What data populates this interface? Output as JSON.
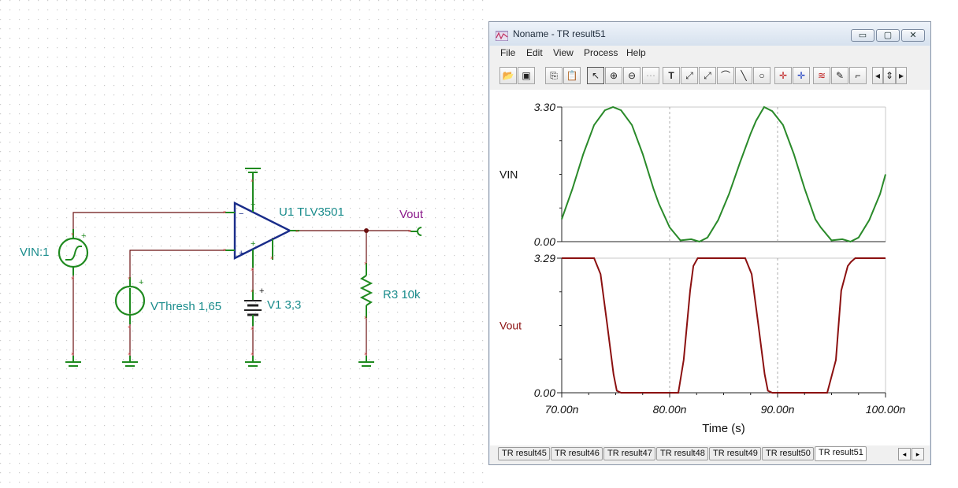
{
  "schematic": {
    "vin_label": "VIN:1",
    "vthresh_label": "VThresh 1,65",
    "opamp_label": "U1 TLV3501",
    "v1_label": "V1 3,3",
    "r3_label": "R3 10k",
    "vout_label": "Vout",
    "plus": "+",
    "minus": "−"
  },
  "window": {
    "title": "Noname - TR result51",
    "menu": [
      "File",
      "Edit",
      "View",
      "Process",
      "Help"
    ],
    "buttons": {
      "minimize": "▭",
      "maximize": "▢",
      "close": "✕"
    }
  },
  "toolbar": {
    "icons": [
      "open-icon",
      "save-icon",
      "copy-icon",
      "paste-icon",
      "pointer-icon",
      "zoom-in-icon",
      "zoom-100-icon",
      "grid-icon",
      "text-icon",
      "cursor-a-icon",
      "cursor-b-icon",
      "curve-icon",
      "line-icon",
      "circle-icon",
      "cursor-marker-a-icon",
      "cursor-marker-b-icon",
      "waveform-icon",
      "probe-icon",
      "flag-icon",
      "scroll-left-icon",
      "scroll-up-down-icon",
      "scroll-right-icon"
    ]
  },
  "tabs": [
    "TR result45",
    "TR result46",
    "TR result47",
    "TR result48",
    "TR result49",
    "TR result50",
    "TR result51"
  ],
  "active_tab": "TR result51",
  "chart_data": {
    "type": "line",
    "xlabel": "Time (s)",
    "x_ticks": [
      "70.00n",
      "80.00n",
      "90.00n",
      "100.00n"
    ],
    "xlim": [
      70,
      100
    ],
    "panels": [
      {
        "name": "VIN",
        "color": "#2a8a2a",
        "ylim": [
          0,
          3.3
        ],
        "y_ticks": [
          "0.00",
          "3.30"
        ],
        "x": [
          70,
          71,
          72,
          73,
          74,
          74.75,
          75.5,
          76.5,
          77.5,
          78.5,
          79,
          80,
          81,
          82,
          82.75,
          83.5,
          84.5,
          85.5,
          86.5,
          87.5,
          88,
          88.75,
          89.5,
          90.5,
          91.5,
          92.5,
          93.5,
          94,
          95,
          96,
          96.75,
          97.5,
          98.5,
          99.5,
          100
        ],
        "y": [
          0.55,
          1.3,
          2.15,
          2.86,
          3.22,
          3.3,
          3.22,
          2.86,
          2.15,
          1.3,
          0.93,
          0.35,
          0.03,
          0.06,
          0.0,
          0.1,
          0.53,
          1.17,
          1.93,
          2.65,
          2.96,
          3.3,
          3.2,
          2.86,
          2.15,
          1.3,
          0.55,
          0.35,
          0.03,
          0.06,
          0.0,
          0.1,
          0.53,
          1.17,
          1.65
        ]
      },
      {
        "name": "Vout",
        "color": "#8b1010",
        "ylim": [
          0,
          3.29
        ],
        "y_ticks": [
          "0.00",
          "3.29"
        ],
        "x": [
          70,
          73,
          73.6,
          74.2,
          74.8,
          75.1,
          75.5,
          80,
          80.8,
          81.3,
          81.9,
          82.2,
          82.6,
          87,
          87.6,
          88.2,
          88.8,
          89.1,
          89.5,
          94.6,
          95.4,
          95.9,
          96.5,
          96.8,
          97.2,
          100
        ],
        "y": [
          3.29,
          3.29,
          2.9,
          1.7,
          0.45,
          0.05,
          0,
          0,
          0,
          0.8,
          2.5,
          3.1,
          3.29,
          3.29,
          2.9,
          1.7,
          0.45,
          0.05,
          0,
          0,
          0.8,
          2.5,
          3.1,
          3.2,
          3.29,
          3.29
        ]
      }
    ]
  }
}
